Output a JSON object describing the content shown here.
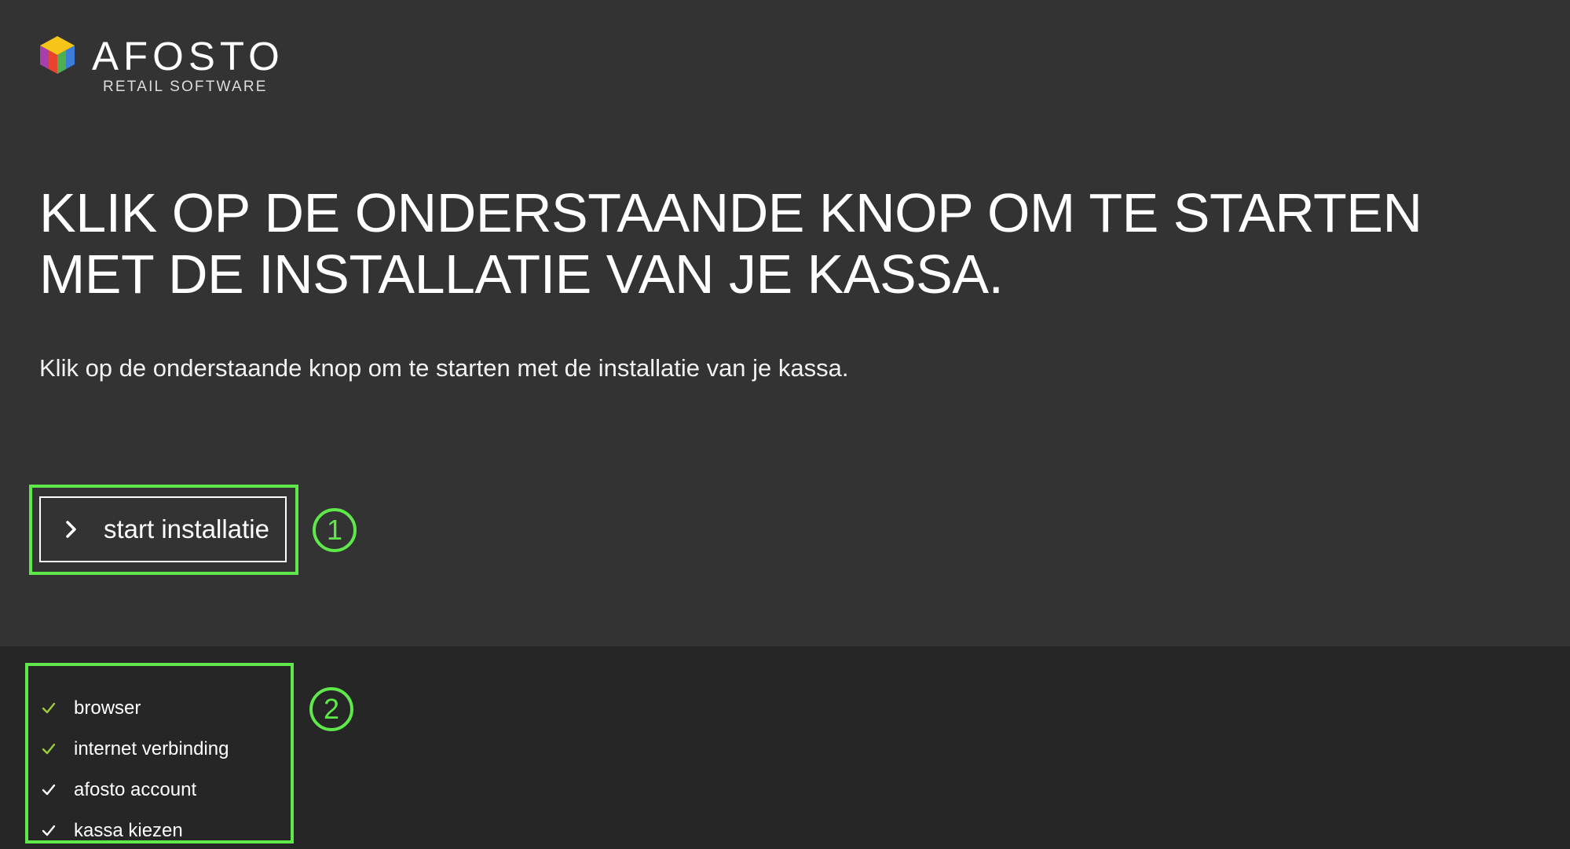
{
  "brand": {
    "name": "AFOSTO",
    "tagline": "RETAIL SOFTWARE"
  },
  "main": {
    "headline": "KLIK OP DE ONDERSTAANDE KNOP OM TE STARTEN MET DE INSTALLATIE VAN JE KASSA.",
    "subtext": "Klik op de onderstaande knop om te starten met de installatie van je kassa.",
    "start_button_label": "start installatie"
  },
  "annotations": {
    "marker_1": "1",
    "marker_2": "2",
    "highlight_color": "#5ee84a"
  },
  "checklist": {
    "items": [
      {
        "label": "browser",
        "status": "done",
        "check_color": "#9ccc3a",
        "icon": "check-icon"
      },
      {
        "label": "internet verbinding",
        "status": "done",
        "check_color": "#9ccc3a",
        "icon": "check-icon"
      },
      {
        "label": "afosto account",
        "status": "current",
        "check_color": "#ffffff",
        "icon": "check-icon"
      },
      {
        "label": "kassa kiezen",
        "status": "current",
        "check_color": "#ffffff",
        "icon": "check-icon"
      }
    ]
  },
  "colors": {
    "background_top": "#333333",
    "background_bottom": "#262626",
    "text": "#ffffff"
  }
}
